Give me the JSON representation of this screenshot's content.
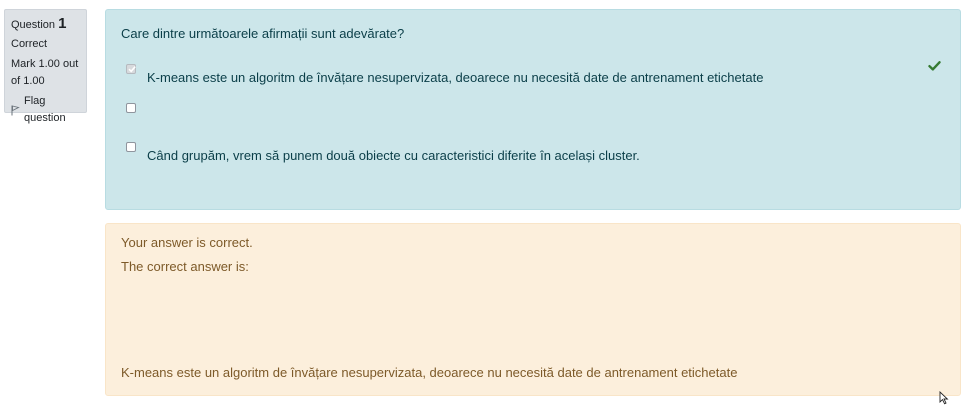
{
  "question_info": {
    "question_label": "Question",
    "question_number": "1",
    "state": "Correct",
    "grade": "Mark 1.00 out of 1.00",
    "flag_label": "Flag question"
  },
  "formulation": {
    "question_text": "Care dintre următoarele afirmații sunt adevărate?",
    "options": [
      {
        "text": "K-means este un algoritm de învățare nesupervizata, deoarece nu necesită date de antrenament etichetate",
        "checked": true
      },
      {
        "text": "",
        "checked": false
      },
      {
        "text": "Când grupăm, vrem să punem două obiecte cu caracteristici diferite în același cluster.",
        "checked": false
      }
    ]
  },
  "outcome": {
    "feedback": "Your answer is correct.",
    "right_answer_label": "The correct answer is:",
    "right_answer": "K-means este un algoritm de învățare nesupervizata, deoarece nu necesită date de antrenament etichetate"
  },
  "icons": {
    "flag": "flag-icon",
    "correct": "checkmark-icon",
    "cursor": "mouse-pointer-icon"
  },
  "colors": {
    "formulation_bg": "#cce6ea",
    "outcome_bg": "#fcefdc",
    "info_bg": "#dee2e6",
    "correct_green": "#357a32"
  }
}
